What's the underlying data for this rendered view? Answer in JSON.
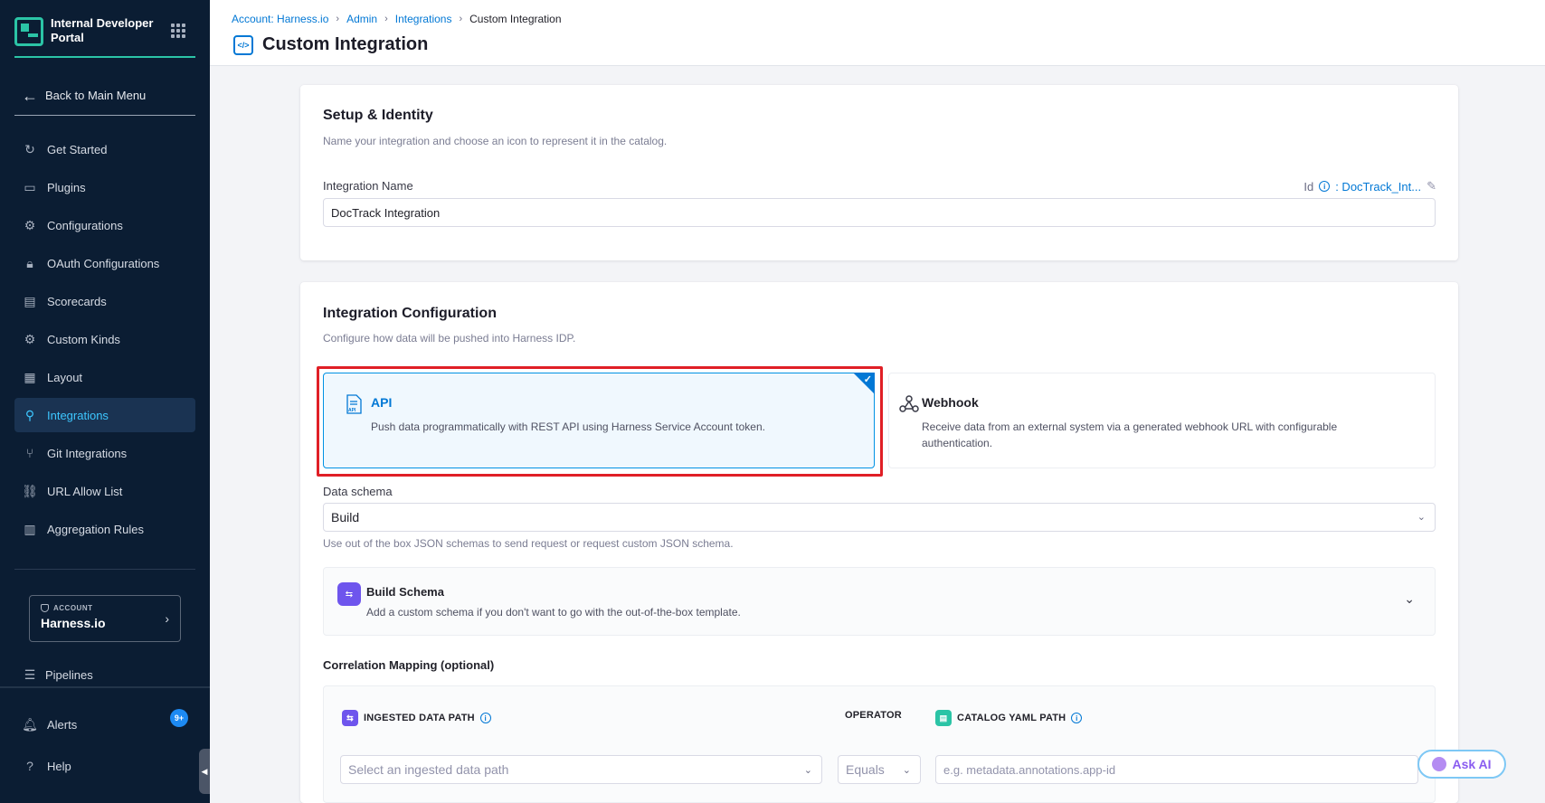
{
  "sidebar": {
    "brand_title": "Internal Developer Portal",
    "back_label": "Back to Main Menu",
    "items": [
      {
        "label": "Get Started",
        "icon": "get-started-icon"
      },
      {
        "label": "Plugins",
        "icon": "plugins-icon"
      },
      {
        "label": "Configurations",
        "icon": "gear-icon"
      },
      {
        "label": "OAuth Configurations",
        "icon": "lock-icon"
      },
      {
        "label": "Scorecards",
        "icon": "scorecard-icon"
      },
      {
        "label": "Custom Kinds",
        "icon": "gear-icon"
      },
      {
        "label": "Layout",
        "icon": "layout-icon"
      },
      {
        "label": "Integrations",
        "icon": "integrations-icon",
        "active": true
      },
      {
        "label": "Git Integrations",
        "icon": "git-icon"
      },
      {
        "label": "URL Allow List",
        "icon": "link-icon"
      },
      {
        "label": "Aggregation Rules",
        "icon": "aggregation-icon"
      }
    ],
    "account_label": "ACCOUNT",
    "account_name": "Harness.io",
    "pipelines_label": "Pipelines",
    "alerts_label": "Alerts",
    "alerts_badge": "9+",
    "help_label": "Help"
  },
  "header": {
    "breadcrumbs": [
      "Account: Harness.io",
      "Admin",
      "Integrations",
      "Custom Integration"
    ],
    "title": "Custom Integration"
  },
  "setup": {
    "title": "Setup & Identity",
    "subtitle": "Name your integration and choose an icon to represent it in the catalog.",
    "name_label": "Integration Name",
    "id_label": "Id",
    "id_value": ": DocTrack_Int...",
    "name_value": "DocTrack Integration"
  },
  "config": {
    "title": "Integration Configuration",
    "subtitle": "Configure how data will be pushed into Harness IDP.",
    "options": [
      {
        "name": "API",
        "desc": "Push data programmatically with REST API using Harness Service Account token.",
        "selected": true
      },
      {
        "name": "Webhook",
        "desc": "Receive data from an external system via a generated webhook URL with configurable authentication.",
        "selected": false
      }
    ],
    "schema_label": "Data schema",
    "schema_value": "Build",
    "schema_help": "Use out of the box JSON schemas to send request or request custom JSON schema.",
    "build_schema_title": "Build Schema",
    "build_schema_sub": "Add a custom schema if you don't want to go with the out-of-the-box template.",
    "corr_title": "Correlation Mapping (optional)",
    "col_ingested": "INGESTED DATA PATH",
    "col_operator": "OPERATOR",
    "col_catalog": "CATALOG YAML PATH",
    "ingested_placeholder": "Select an ingested data path",
    "operator_value": "Equals",
    "catalog_placeholder": "e.g. metadata.annotations.app-id"
  },
  "ask_ai": "Ask AI",
  "colors": {
    "sidebar_bg": "#0b1d33",
    "accent": "#0278d5",
    "teal": "#2bc4a6",
    "highlight": "#e01f26"
  }
}
